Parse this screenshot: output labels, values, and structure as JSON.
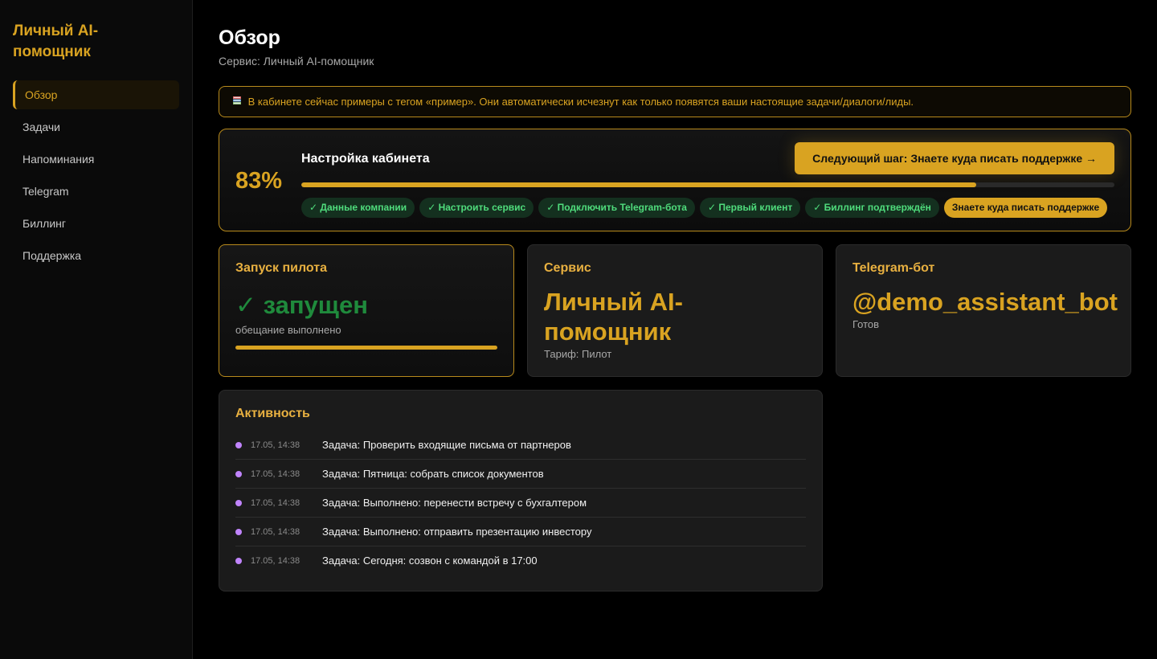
{
  "sidebar": {
    "brand": "Личный AI-помощник",
    "items": [
      {
        "label": "Обзор",
        "active": true
      },
      {
        "label": "Задачи",
        "active": false
      },
      {
        "label": "Напоминания",
        "active": false
      },
      {
        "label": "Telegram",
        "active": false
      },
      {
        "label": "Биллинг",
        "active": false
      },
      {
        "label": "Поддержка",
        "active": false
      }
    ]
  },
  "header": {
    "title": "Обзор",
    "subtitle": "Сервис: Личный AI-помощник"
  },
  "notice": {
    "icon": "book-icon",
    "text": "В кабинете сейчас примеры с тегом «пример». Они автоматически исчезнут как только появятся ваши настоящие задачи/диалоги/лиды."
  },
  "setup": {
    "percent_label": "83%",
    "progress": 0.83,
    "title": "Настройка кабинета",
    "next_button": "Следующий шаг: Знаете куда писать поддержке →",
    "chips": [
      {
        "label": "✓ Данные компании",
        "done": true
      },
      {
        "label": "✓ Настроить сервис",
        "done": true
      },
      {
        "label": "✓ Подключить Telegram-бота",
        "done": true
      },
      {
        "label": "✓ Первый клиент",
        "done": true
      },
      {
        "label": "✓ Биллинг подтверждён",
        "done": true
      },
      {
        "label": "Знаете куда писать поддержке",
        "done": false
      }
    ]
  },
  "cards": {
    "pilot": {
      "title": "Запуск пилота",
      "value": "✓ запущен",
      "sub": "обещание выполнено",
      "progress": 1.0
    },
    "service": {
      "title": "Сервис",
      "value": "Личный AI-помощник",
      "sub": "Тариф: Пилот"
    },
    "telegram": {
      "title": "Telegram-бот",
      "value": "@demo_assistant_bot",
      "sub": "Готов"
    }
  },
  "activity": {
    "title": "Активность",
    "rows": [
      {
        "time": "17.05, 14:38",
        "text": "Задача: Проверить входящие письма от партнеров"
      },
      {
        "time": "17.05, 14:38",
        "text": "Задача: Пятница: собрать список документов"
      },
      {
        "time": "17.05, 14:38",
        "text": "Задача: Выполнено: перенести встречу с бухгалтером"
      },
      {
        "time": "17.05, 14:38",
        "text": "Задача: Выполнено: отправить презентацию инвестору"
      },
      {
        "time": "17.05, 14:38",
        "text": "Задача: Сегодня: созвон с командой в 17:00"
      }
    ]
  },
  "colors": {
    "accent": "#d9a321",
    "success": "#1f8a3c",
    "chip_text": "#4fdc7c",
    "dot": "#c084fc"
  }
}
